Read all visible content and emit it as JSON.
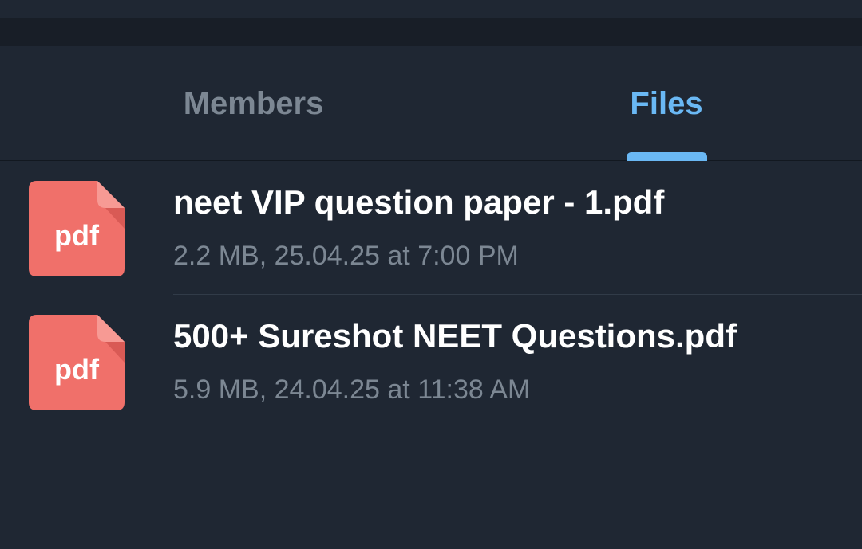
{
  "tabs": [
    {
      "label": "Members",
      "active": false
    },
    {
      "label": "Files",
      "active": true
    }
  ],
  "colors": {
    "background": "#1f2733",
    "active_tab": "#6ab8f4",
    "inactive_tab": "#7c8793",
    "pdf_icon": "#f0706a"
  },
  "files": [
    {
      "icon": "pdf-file-icon",
      "ext": "pdf",
      "name": "neet VIP question paper - 1.pdf",
      "meta": "2.2 MB, 25.04.25 at 7:00 PM"
    },
    {
      "icon": "pdf-file-icon",
      "ext": "pdf",
      "name": "500+ Sureshot NEET Questions.pdf",
      "meta": "5.9 MB, 24.04.25 at 11:38 AM"
    }
  ]
}
